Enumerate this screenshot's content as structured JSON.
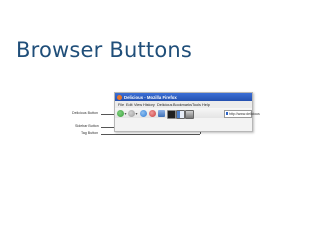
{
  "slide": {
    "title": "Browser Buttons"
  },
  "callouts": {
    "delicious_button": "Delicious Button",
    "sidebar_button": "Sidebar Button",
    "tag_button": "Tag Button"
  },
  "browser": {
    "window_title": "Delicious - Mozilla Firefox",
    "menu": [
      "File",
      "Edit",
      "View",
      "History",
      "Delicious",
      "Bookmarks",
      "Tools",
      "Help"
    ],
    "url": "http://www.delicious",
    "colors": {
      "back": "#3aa03a",
      "forward": "#9a9a9a",
      "reload": "#2e7bd6",
      "stop": "#c93b3b",
      "home": "#3d6fb5",
      "delicious": "#1f1f1f",
      "sidebar": "#4a7dc9",
      "tag": "#7a7a7a"
    }
  }
}
